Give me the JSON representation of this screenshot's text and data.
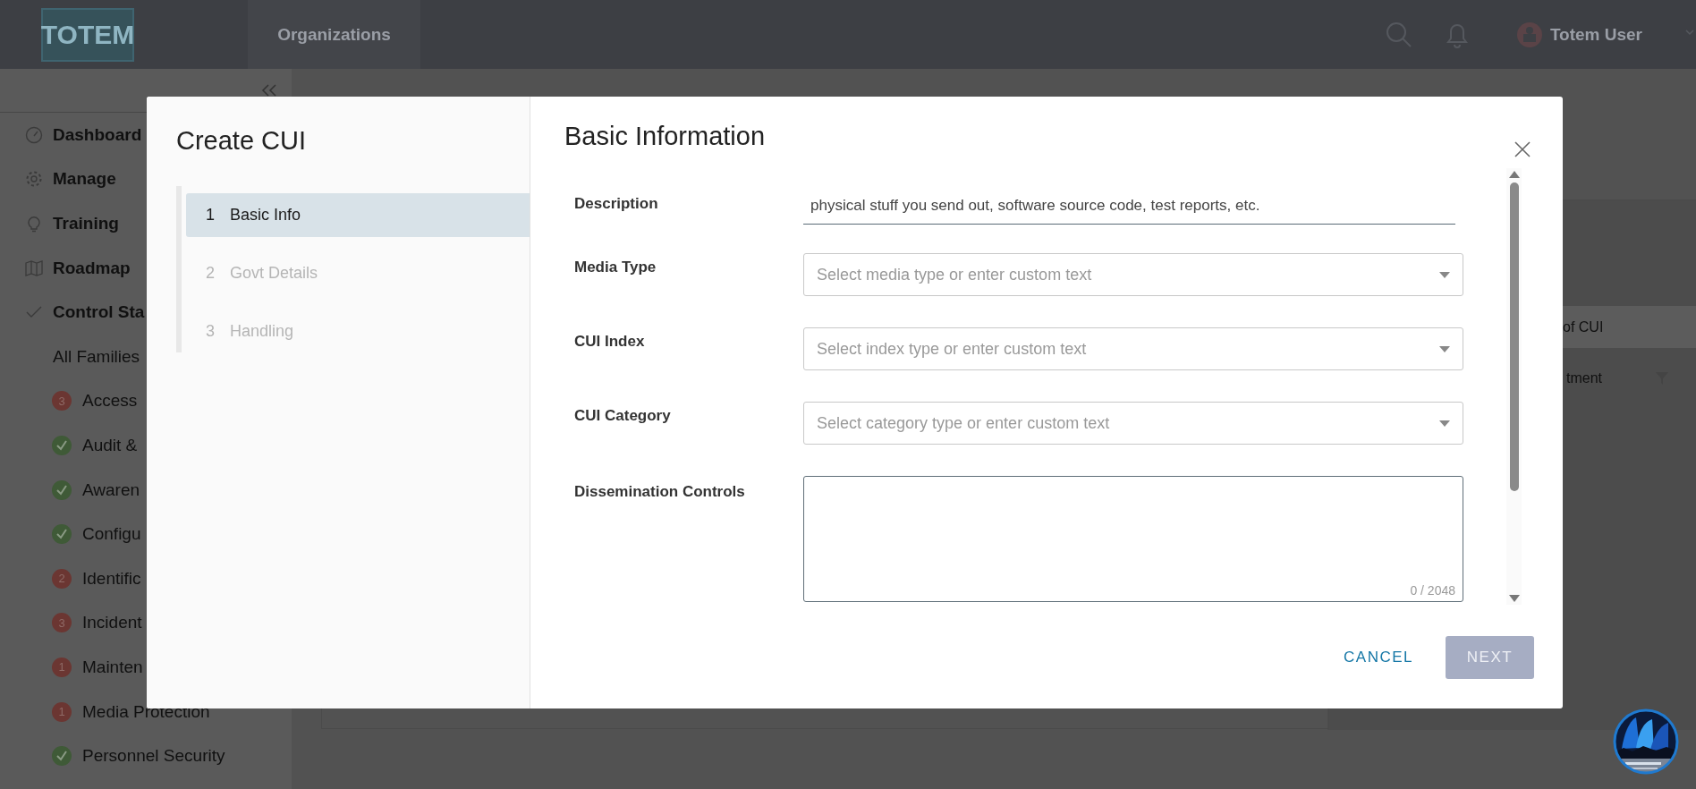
{
  "header": {
    "logo": "TOTEM",
    "nav_tab": "Organizations",
    "user": "Totem User"
  },
  "sidebar": {
    "items": [
      {
        "label": "Dashboard"
      },
      {
        "label": "Manage"
      },
      {
        "label": "Training"
      },
      {
        "label": "Roadmap"
      },
      {
        "label": "Control Sta"
      }
    ],
    "families_label": "All Families",
    "families": [
      {
        "label": "Access",
        "kind": "count",
        "count": "3"
      },
      {
        "label": "Audit &",
        "kind": "done"
      },
      {
        "label": "Awaren",
        "kind": "done"
      },
      {
        "label": "Configu",
        "kind": "done"
      },
      {
        "label": "Identific",
        "kind": "count",
        "count": "2"
      },
      {
        "label": "Incident",
        "kind": "count",
        "count": "3"
      },
      {
        "label": "Mainten",
        "kind": "count",
        "count": "1"
      },
      {
        "label": "Media Protection",
        "kind": "count",
        "count": "1"
      },
      {
        "label": "Personnel Security",
        "kind": "done"
      }
    ]
  },
  "main": {
    "tab": "of CUI",
    "column": "tment"
  },
  "modal": {
    "title": "Create CUI",
    "steps": [
      {
        "number": "1",
        "label": "Basic Info",
        "selected": true
      },
      {
        "number": "2",
        "label": "Govt Details",
        "selected": false
      },
      {
        "number": "3",
        "label": "Handling",
        "selected": false
      }
    ],
    "heading": "Basic Information",
    "fields": [
      {
        "kind": "text",
        "label": "Description",
        "value": "physical stuff you send out, software source code, test reports, etc."
      },
      {
        "kind": "select",
        "label": "Media Type",
        "placeholder": "Select media type or enter custom text"
      },
      {
        "kind": "select",
        "label": "CUI Index",
        "placeholder": "Select index type or enter custom text"
      },
      {
        "kind": "select",
        "label": "CUI Category",
        "placeholder": "Select category type or enter custom text"
      },
      {
        "kind": "textarea",
        "label": "Dissemination Controls",
        "counter": "0 / 2048"
      }
    ],
    "buttons": {
      "cancel": "CANCEL",
      "next": {
        "label": "NEXT",
        "disabled": true
      }
    }
  }
}
